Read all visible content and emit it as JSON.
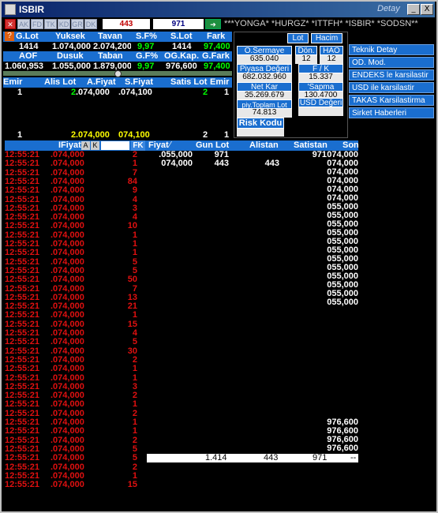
{
  "window": {
    "title": "ISBIR",
    "right_label": "Detay",
    "minimize": "_",
    "close": "X"
  },
  "toolbar": {
    "buttons": [
      "AK",
      "FD",
      "TK",
      "KD",
      "GR",
      "DK"
    ],
    "val1": "443",
    "val2": "971",
    "ticker": "***YONGA* *HURGZ* *ITTFH* *ISBIR* *SODSN**"
  },
  "summary": {
    "row1_headers": [
      "G.Lot",
      "Yuksek",
      "Tavan",
      "S.F%",
      "S.Lot",
      "Fark"
    ],
    "row1_values": [
      "1414",
      "1.074,000",
      "2.074,200",
      "9,97",
      "1414",
      "97,400"
    ],
    "row2_headers": [
      "AOF",
      "Dusuk",
      "Taban",
      "G.F%",
      "OG.Kap.",
      "G.Fark"
    ],
    "row2_values": [
      "1.060,953",
      "1.055,000",
      "1.879,000",
      "9,97",
      "976,600",
      "97,400"
    ],
    "depth_headers": [
      "Emir",
      "Alis Lot",
      "A.Fiyat",
      "S.Fiyat",
      "Satis Lot",
      "Emir"
    ],
    "depth_row1": [
      "1",
      "2",
      ".074,000",
      ".074,100",
      "2",
      "1"
    ],
    "depth_total": [
      "1",
      "2",
      ".074,000",
      "074,100",
      "2",
      "1"
    ]
  },
  "panel": {
    "lot": "Lot",
    "hacim": "Hacim",
    "o_sermaye_label": "O.Sermaye",
    "o_sermaye": "635.040",
    "don_label": "Dön.",
    "don": "12",
    "hao_label": "HAO",
    "hao": "12",
    "piyasa_label": "Piyasa Değeri",
    "piyasa": "682.032.960",
    "fk_label": "F / K",
    "fk": "15.337",
    "net_kar_label": "Net Kar",
    "net_kar": "35.269.679",
    "sapma_label": "'Sapma",
    "sapma": "130.4700",
    "piy_toplam_label": "piy.Toplam Lot",
    "piy_toplam": "74.813",
    "usd_label": "USD Değeri",
    "risk": "Risk Kodu"
  },
  "menu": [
    "Teknik Detay",
    "OD. Mod.",
    "ENDEKS le karsilastir",
    "USD ile karsilastir",
    "TAKAS Karsilastirma",
    "Sirket Haberleri"
  ],
  "trades_header": {
    "fiyat": "IFiyat",
    "a": "A",
    "k": "K",
    "fk": "FK",
    "fiyat2": "Fiyat",
    "gun_lot": "Gun Lot",
    "alistan": "Alistan",
    "satistan": "Satistan",
    "son": "Son"
  },
  "trades": [
    {
      "t": "12:55:21",
      "p": ".074,000",
      "l": "2"
    },
    {
      "t": "12:55:21",
      "p": ".074,000",
      "l": "1"
    },
    {
      "t": "12:55:21",
      "p": ".074,000",
      "l": "7"
    },
    {
      "t": "12:55:21",
      "p": ".074,000",
      "l": "84"
    },
    {
      "t": "12:55:21",
      "p": ".074,000",
      "l": "9"
    },
    {
      "t": "12:55:21",
      "p": ".074,000",
      "l": "4"
    },
    {
      "t": "12:55:21",
      "p": ".074,000",
      "l": "3"
    },
    {
      "t": "12:55:21",
      "p": ".074,000",
      "l": "4"
    },
    {
      "t": "12:55:21",
      "p": ".074,000",
      "l": "10"
    },
    {
      "t": "12:55:21",
      "p": ".074,000",
      "l": "1"
    },
    {
      "t": "12:55:21",
      "p": ".074,000",
      "l": "1"
    },
    {
      "t": "12:55:21",
      "p": ".074,000",
      "l": "1"
    },
    {
      "t": "12:55:21",
      "p": ".074,000",
      "l": "5"
    },
    {
      "t": "12:55:21",
      "p": ".074,000",
      "l": "5"
    },
    {
      "t": "12:55:21",
      "p": ".074,000",
      "l": "50"
    },
    {
      "t": "12:55:21",
      "p": ".074,000",
      "l": "7"
    },
    {
      "t": "12:55:21",
      "p": ".074,000",
      "l": "13"
    },
    {
      "t": "12:55:21",
      "p": ".074,000",
      "l": "21"
    },
    {
      "t": "12:55:21",
      "p": ".074,000",
      "l": "1"
    },
    {
      "t": "12:55:21",
      "p": ".074,000",
      "l": "15"
    },
    {
      "t": "12:55:21",
      "p": ".074,000",
      "l": "4"
    },
    {
      "t": "12:55:21",
      "p": ".074,000",
      "l": "5"
    },
    {
      "t": "12:55:21",
      "p": ".074,000",
      "l": "30"
    },
    {
      "t": "12:55:21",
      "p": ".074,000",
      "l": "2"
    },
    {
      "t": "12:55:21",
      "p": ".074,000",
      "l": "1"
    },
    {
      "t": "12:55:21",
      "p": ".074,000",
      "l": "1"
    },
    {
      "t": "12:55:21",
      "p": ".074,000",
      "l": "3"
    },
    {
      "t": "12:55:21",
      "p": ".074,000",
      "l": "2"
    },
    {
      "t": "12:55:21",
      "p": ".074,000",
      "l": "1"
    },
    {
      "t": "12:55:21",
      "p": ".074,000",
      "l": "2"
    },
    {
      "t": "12:55:21",
      "p": ".074,000",
      "l": "1"
    },
    {
      "t": "12:55:21",
      "p": ".074,000",
      "l": "1"
    },
    {
      "t": "12:55:21",
      "p": ".074,000",
      "l": "2"
    },
    {
      "t": "12:55:21",
      "p": ".074,000",
      "l": "5"
    },
    {
      "t": "12:55:21",
      "p": ".074,000",
      "l": "5"
    },
    {
      "t": "12:55:21",
      "p": ".074,000",
      "l": "2"
    },
    {
      "t": "12:55:21",
      "p": ".074,000",
      "l": "1"
    },
    {
      "t": "12:55:21",
      "p": ".074,000",
      "l": "15"
    }
  ],
  "price_table": [
    {
      "f": ".055,000",
      "g": "971",
      "a": "",
      "s": "971",
      "son": "074,000"
    },
    {
      "f": "074,000",
      "g": "443",
      "a": "443",
      "s": "",
      "son": "074,000"
    },
    {
      "f": "",
      "g": "",
      "a": "",
      "s": "",
      "son": "074,000"
    },
    {
      "f": "",
      "g": "",
      "a": "",
      "s": "",
      "son": "074,000"
    },
    {
      "f": "",
      "g": "",
      "a": "",
      "s": "",
      "son": "074,000"
    },
    {
      "f": "",
      "g": "",
      "a": "",
      "s": "",
      "son": "074,000"
    },
    {
      "f": "",
      "g": "",
      "a": "",
      "s": "",
      "son": "055,000"
    },
    {
      "f": "",
      "g": "",
      "a": "",
      "s": "",
      "son": "055,000"
    },
    {
      "f": "",
      "g": "",
      "a": "",
      "s": "",
      "son": "055,000"
    },
    {
      "f": "",
      "g": "",
      "a": "",
      "s": "",
      "son": "055,000"
    },
    {
      "f": "",
      "g": "",
      "a": "",
      "s": "",
      "son": "055,000"
    },
    {
      "f": "",
      "g": "",
      "a": "",
      "s": "",
      "son": "055,000"
    },
    {
      "f": "",
      "g": "",
      "a": "",
      "s": "",
      "son": "055,000"
    },
    {
      "f": "",
      "g": "",
      "a": "",
      "s": "",
      "son": "055,000"
    },
    {
      "f": "",
      "g": "",
      "a": "",
      "s": "",
      "son": "055,000"
    },
    {
      "f": "",
      "g": "",
      "a": "",
      "s": "",
      "son": "055,000"
    },
    {
      "f": "",
      "g": "",
      "a": "",
      "s": "",
      "son": "055,000"
    },
    {
      "f": "",
      "g": "",
      "a": "",
      "s": "",
      "son": "055,000"
    }
  ],
  "son_lower": [
    "976,600",
    "976,600",
    "976,600",
    "976,600"
  ],
  "total_row": {
    "gun_lot": "1.414",
    "alistan": "443",
    "satistan": "971",
    "son": "--"
  }
}
